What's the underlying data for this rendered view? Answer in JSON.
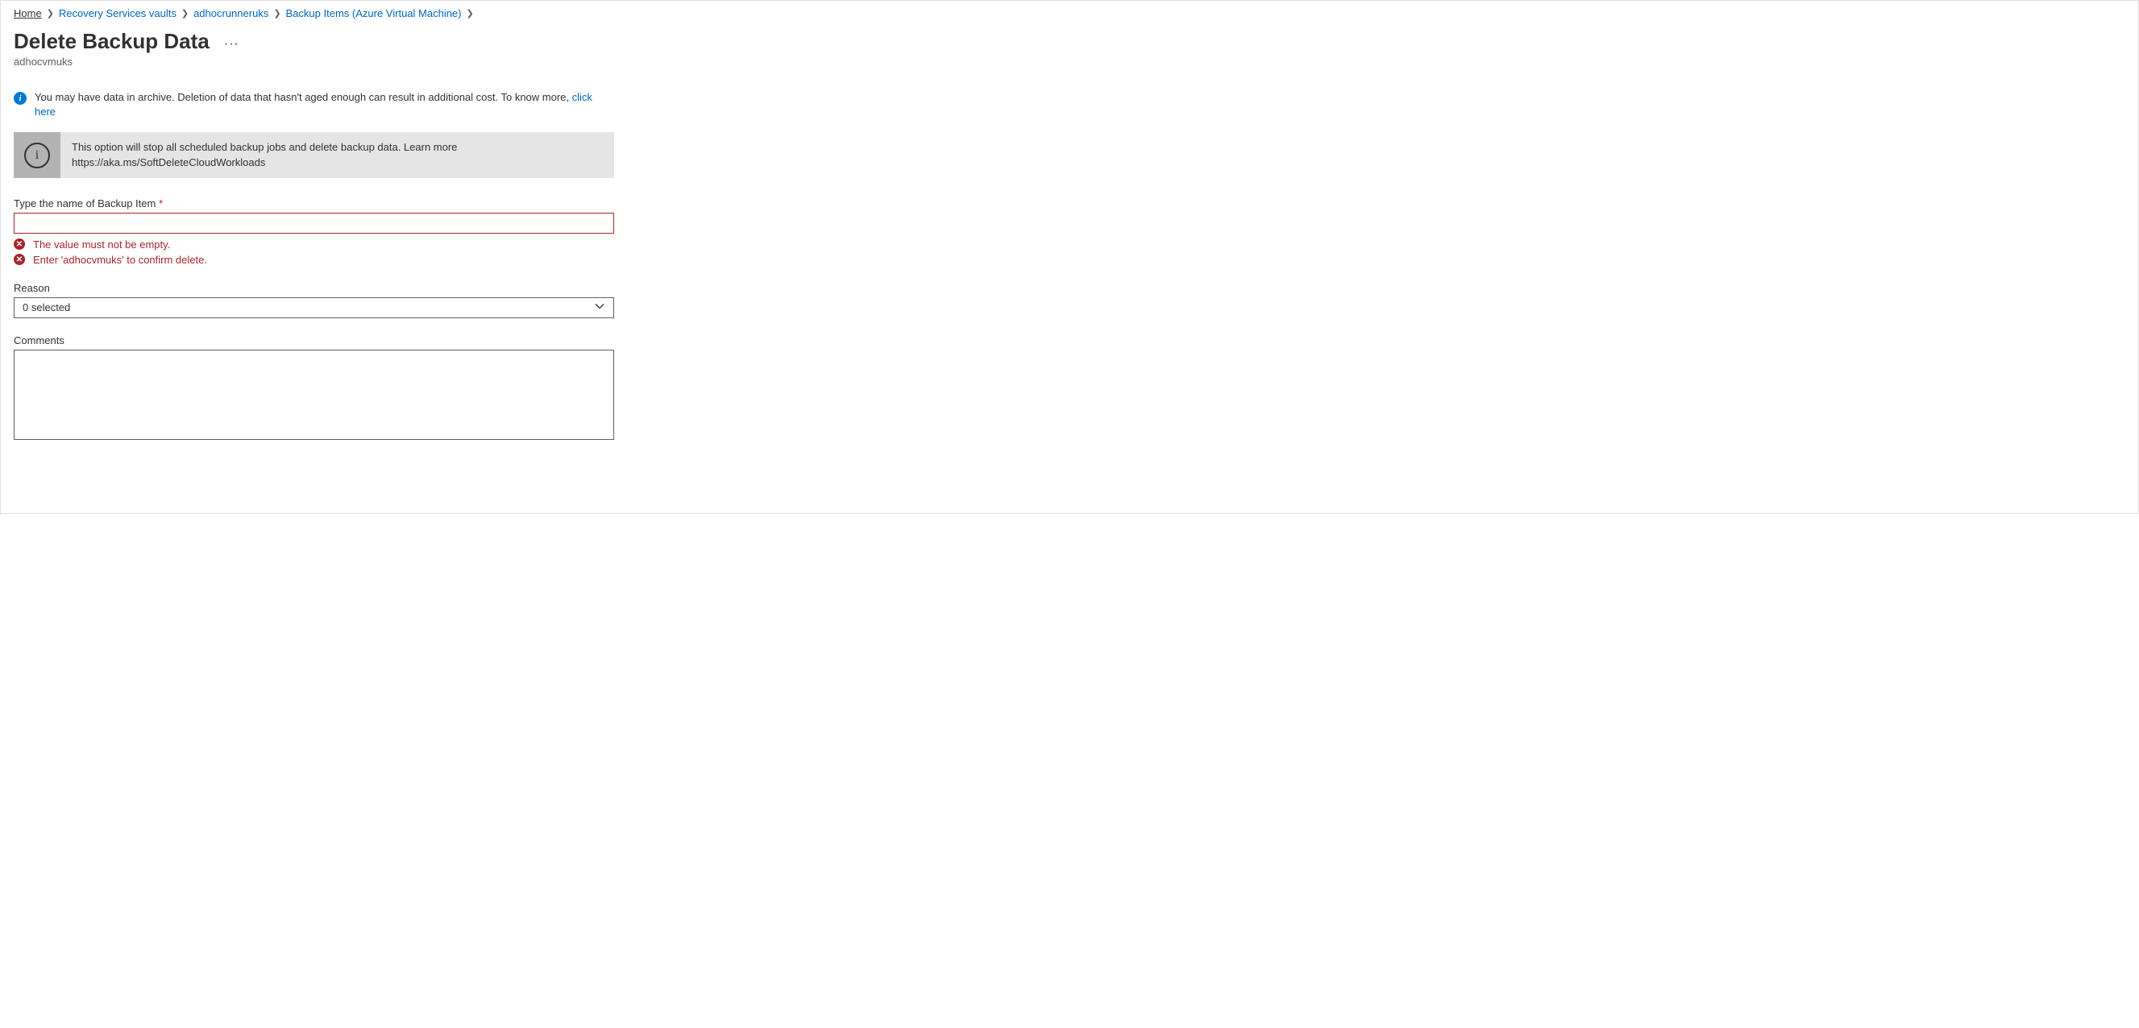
{
  "breadcrumb": {
    "home": "Home",
    "vaults": "Recovery Services vaults",
    "runner": "adhocrunneruks",
    "items": "Backup Items (Azure Virtual Machine)"
  },
  "header": {
    "title": "Delete Backup Data",
    "subtitle": "adhocvmuks",
    "more": "···"
  },
  "info_banner": {
    "text_before_link": "You may have data in archive. Deletion of data that hasn't aged enough can result in additional cost. To know more, ",
    "link_text": "click here"
  },
  "grey_banner": {
    "line1": "This option will stop all scheduled backup jobs and delete backup data. Learn more",
    "line2": "https://aka.ms/SoftDeleteCloudWorkloads"
  },
  "form": {
    "name_label": "Type the name of Backup Item",
    "name_value": "",
    "error1": "The value must not be empty.",
    "error2": "Enter 'adhocvmuks' to confirm delete.",
    "reason_label": "Reason",
    "reason_value": "0 selected",
    "comments_label": "Comments",
    "comments_value": ""
  }
}
